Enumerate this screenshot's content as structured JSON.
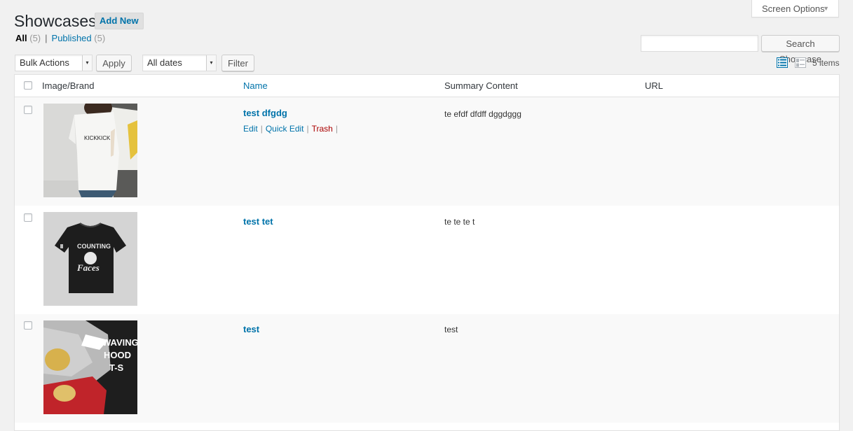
{
  "screen_options": {
    "label": "Screen Options",
    "caret": "▼"
  },
  "header": {
    "title": "Showcases",
    "add_new": "Add New"
  },
  "filters": {
    "all_label": "All",
    "all_count": "(5)",
    "separator": "|",
    "published_label": "Published",
    "published_count": "(5)"
  },
  "search": {
    "input_value": "",
    "button": "Search Showcase"
  },
  "toolbar": {
    "bulk_actions": "Bulk Actions",
    "apply": "Apply",
    "dates": "All dates",
    "filter": "Filter",
    "items_count": "5 items"
  },
  "table": {
    "columns": [
      "Image/Brand",
      "Name",
      "Summary Content",
      "URL"
    ],
    "rows": [
      {
        "name": "test dfgdg",
        "summary": "te efdf dfdff dggdggg",
        "url": "",
        "actions": {
          "edit": "Edit",
          "quick_edit": "Quick Edit",
          "trash": "Trash",
          "sep": "|"
        }
      },
      {
        "name": "test tet",
        "summary": "te te te t",
        "url": ""
      },
      {
        "name": "test",
        "summary": "test",
        "url": ""
      }
    ]
  },
  "thumbnails": {
    "row1_shirt_text": "KICKKICK",
    "row2_shirt_text_top": "COUNTING",
    "row2_shirt_text_bottom": "Faces",
    "row3_text_lines": [
      "WAVING",
      "HOOD",
      "T-S"
    ]
  },
  "colors": {
    "link": "#0073aa",
    "trash": "#aa0000",
    "view_active": "#0073aa"
  }
}
